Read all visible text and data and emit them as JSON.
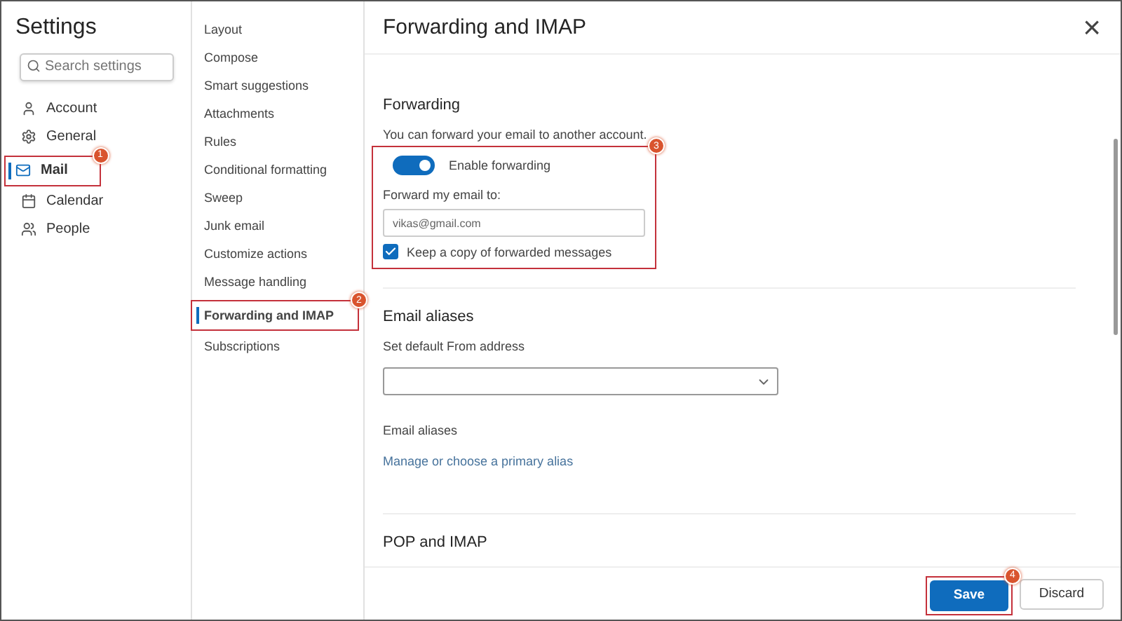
{
  "sidebar": {
    "title": "Settings",
    "search": {
      "placeholder": "Search settings"
    },
    "items": [
      {
        "label": "Account",
        "selected": false
      },
      {
        "label": "General",
        "selected": false
      },
      {
        "label": "Mail",
        "selected": true,
        "callout": "1"
      },
      {
        "label": "Calendar",
        "selected": false
      },
      {
        "label": "People",
        "selected": false
      }
    ]
  },
  "subnav": {
    "items": [
      {
        "label": "Layout",
        "selected": false
      },
      {
        "label": "Compose",
        "selected": false
      },
      {
        "label": "Smart suggestions",
        "selected": false
      },
      {
        "label": "Attachments",
        "selected": false
      },
      {
        "label": "Rules",
        "selected": false
      },
      {
        "label": "Conditional formatting",
        "selected": false
      },
      {
        "label": "Sweep",
        "selected": false
      },
      {
        "label": "Junk email",
        "selected": false
      },
      {
        "label": "Customize actions",
        "selected": false
      },
      {
        "label": "Message handling",
        "selected": false
      },
      {
        "label": "Forwarding and IMAP",
        "selected": true,
        "callout": "2"
      },
      {
        "label": "Subscriptions",
        "selected": false
      }
    ]
  },
  "panel": {
    "title": "Forwarding and IMAP",
    "close": "×",
    "forwarding": {
      "heading": "Forwarding",
      "description": "You can forward your email to another account.",
      "callout": "3",
      "toggle": {
        "label": "Enable forwarding",
        "on": true
      },
      "address_label": "Forward my email to:",
      "address_value": "vikas@gmail.com",
      "keep_copy": {
        "label": "Keep a copy of forwarded messages",
        "checked": true
      }
    },
    "aliases": {
      "heading": "Email aliases",
      "from_label": "Set default From address",
      "aliases_label": "Email aliases",
      "link": "Manage or choose a primary alias"
    },
    "pop": {
      "heading": "POP and IMAP"
    }
  },
  "footer": {
    "save": "Save",
    "save_callout": "4",
    "discard": "Discard"
  }
}
